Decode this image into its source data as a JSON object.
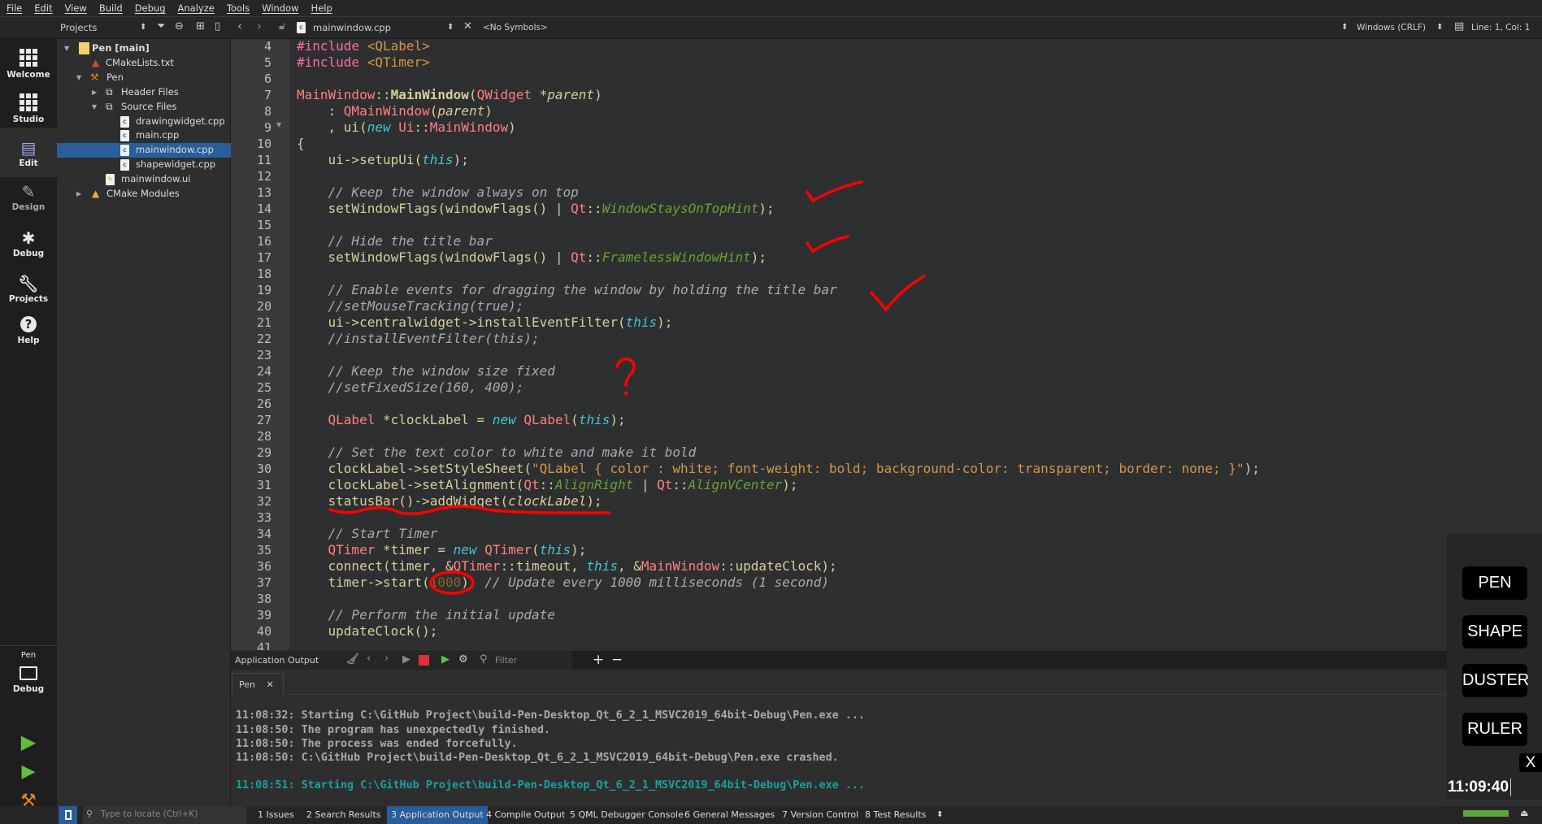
{
  "menu": [
    "File",
    "Edit",
    "View",
    "Build",
    "Debug",
    "Analyze",
    "Tools",
    "Window",
    "Help"
  ],
  "projects_panel": {
    "title": "Projects",
    "items": [
      {
        "label": "Pen [main]",
        "bold": true
      },
      {
        "label": "CMakeLists.txt"
      },
      {
        "label": "Pen"
      },
      {
        "label": "Header Files"
      },
      {
        "label": "Source Files"
      },
      {
        "label": "drawingwidget.cpp"
      },
      {
        "label": "main.cpp"
      },
      {
        "label": "mainwindow.cpp",
        "selected": true
      },
      {
        "label": "shapewidget.cpp"
      },
      {
        "label": "mainwindow.ui"
      },
      {
        "label": "CMake Modules"
      }
    ]
  },
  "editor_toolbar": {
    "filename": "mainwindow.cpp",
    "symbols": "<No Symbols>",
    "line_ending": "Windows (CRLF)",
    "cursor": "Line: 1, Col: 1"
  },
  "modes": [
    {
      "label": "Welcome",
      "icon": "grid-icon"
    },
    {
      "label": "Studio",
      "icon": "grid-icon"
    },
    {
      "label": "Edit",
      "icon": "document-icon",
      "active": true
    },
    {
      "label": "Design",
      "icon": "pencil-icon"
    },
    {
      "label": "Debug",
      "icon": "bug-icon"
    },
    {
      "label": "Projects",
      "icon": "wrench-icon"
    },
    {
      "label": "Help",
      "icon": "help-icon"
    }
  ],
  "kit": {
    "project": "Pen",
    "config": "Debug"
  },
  "code": {
    "first_line": 4,
    "lines": [
      [
        [
          "p",
          "#include"
        ],
        [
          "",
          " "
        ],
        [
          "i",
          "<QLabel>"
        ]
      ],
      [
        [
          "p",
          "#include"
        ],
        [
          "",
          " "
        ],
        [
          "i",
          "<QTimer>"
        ]
      ],
      [],
      [
        [
          "t",
          "MainWindow"
        ],
        [
          "",
          "::"
        ],
        [
          "fb",
          "MainWindow"
        ],
        [
          "",
          "("
        ],
        [
          "t",
          "QWidget"
        ],
        [
          "",
          " *"
        ],
        [
          "v",
          "parent"
        ],
        [
          "",
          ")"
        ]
      ],
      [
        [
          "",
          "    : "
        ],
        [
          "t",
          "QMainWindow"
        ],
        [
          "",
          "("
        ],
        [
          "v",
          "parent"
        ],
        [
          "",
          ")"
        ]
      ],
      [
        [
          "",
          "    , ui("
        ],
        [
          "n",
          "new"
        ],
        [
          "",
          " "
        ],
        [
          "t",
          "Ui"
        ],
        [
          "",
          "::"
        ],
        [
          "t",
          "MainWindow"
        ],
        [
          "",
          ")"
        ]
      ],
      [
        [
          "",
          "{"
        ]
      ],
      [
        [
          "",
          "    ui->setupUi("
        ],
        [
          "n",
          "this"
        ],
        [
          "",
          ");"
        ]
      ],
      [],
      [
        [
          "c",
          "    // Keep the window always on top"
        ]
      ],
      [
        [
          "",
          "    setWindowFlags(windowFlags() | "
        ],
        [
          "t",
          "Qt"
        ],
        [
          "",
          "::"
        ],
        [
          "e",
          "WindowStaysOnTopHint"
        ],
        [
          "",
          ");"
        ]
      ],
      [],
      [
        [
          "c",
          "    // Hide the title bar"
        ]
      ],
      [
        [
          "",
          "    setWindowFlags(windowFlags() | "
        ],
        [
          "t",
          "Qt"
        ],
        [
          "",
          "::"
        ],
        [
          "e",
          "FramelessWindowHint"
        ],
        [
          "",
          ");"
        ]
      ],
      [],
      [
        [
          "c",
          "    // Enable events for dragging the window by holding the title bar"
        ]
      ],
      [
        [
          "c",
          "    //setMouseTracking(true);"
        ]
      ],
      [
        [
          "",
          "    ui->centralwidget->installEventFilter("
        ],
        [
          "n",
          "this"
        ],
        [
          "",
          ");"
        ]
      ],
      [
        [
          "c",
          "    //installEventFilter(this);"
        ]
      ],
      [],
      [
        [
          "c",
          "    // Keep the window size fixed"
        ]
      ],
      [
        [
          "c",
          "    //setFixedSize(160, 400);"
        ]
      ],
      [],
      [
        [
          "",
          "    "
        ],
        [
          "t",
          "QLabel"
        ],
        [
          "",
          " *clockLabel = "
        ],
        [
          "n",
          "new"
        ],
        [
          "",
          " "
        ],
        [
          "t",
          "QLabel"
        ],
        [
          "",
          "("
        ],
        [
          "n",
          "this"
        ],
        [
          "",
          ");"
        ]
      ],
      [],
      [
        [
          "c",
          "    // Set the text color to white and make it bold"
        ]
      ],
      [
        [
          "",
          "    clockLabel->setStyleSheet("
        ],
        [
          "s",
          "\"QLabel { color : white; font-weight: bold; background-color: transparent; border: none; }\""
        ],
        [
          "",
          ");"
        ]
      ],
      [
        [
          "",
          "    clockLabel->setAlignment("
        ],
        [
          "t",
          "Qt"
        ],
        [
          "",
          "::"
        ],
        [
          "e",
          "AlignRight"
        ],
        [
          "",
          " | "
        ],
        [
          "t",
          "Qt"
        ],
        [
          "",
          "::"
        ],
        [
          "e",
          "AlignVCenter"
        ],
        [
          "",
          ");"
        ]
      ],
      [
        [
          "",
          "    statusBar()->addWidget("
        ],
        [
          "v",
          "clockLabel"
        ],
        [
          "",
          ");"
        ]
      ],
      [],
      [
        [
          "c",
          "    // Start Timer"
        ]
      ],
      [
        [
          "",
          "    "
        ],
        [
          "t",
          "QTimer"
        ],
        [
          "",
          " *timer = "
        ],
        [
          "n",
          "new"
        ],
        [
          "",
          " "
        ],
        [
          "t",
          "QTimer"
        ],
        [
          "",
          "("
        ],
        [
          "n",
          "this"
        ],
        [
          "",
          ");"
        ]
      ],
      [
        [
          "",
          "    connect(timer, &"
        ],
        [
          "t",
          "QTimer"
        ],
        [
          "",
          "::timeout, "
        ],
        [
          "n",
          "this"
        ],
        [
          "",
          ", &"
        ],
        [
          "t",
          "MainWindow"
        ],
        [
          "",
          "::updateClock);"
        ]
      ],
      [
        [
          "",
          "    timer->start("
        ],
        [
          "d",
          "1000"
        ],
        [
          "",
          "); "
        ],
        [
          "c",
          "// Update every 1000 milliseconds (1 second)"
        ]
      ],
      [],
      [
        [
          "c",
          "    // Perform the initial update"
        ]
      ],
      [
        [
          "",
          "    updateClock();"
        ]
      ],
      []
    ]
  },
  "output": {
    "title": "Application Output",
    "filter_placeholder": "Filter",
    "tab": "Pen",
    "lines": [
      {
        "text": "11:08:32: Starting C:\\GitHub Project\\build-Pen-Desktop_Qt_6_2_1_MSVC2019_64bit-Debug\\Pen.exe ..."
      },
      {
        "text": "11:08:50: The program has unexpectedly finished."
      },
      {
        "text": "11:08:50: The process was ended forcefully."
      },
      {
        "text": "11:08:50: C:\\GitHub Project\\build-Pen-Desktop_Qt_6_2_1_MSVC2019_64bit-Debug\\Pen.exe crashed."
      },
      {
        "text": "11:08:51: Starting C:\\GitHub Project\\build-Pen-Desktop_Qt_6_2_1_MSVC2019_64bit-Debug\\Pen.exe ...",
        "highlight": true
      }
    ]
  },
  "statusbar": {
    "locate_placeholder": "Type to locate (Ctrl+K)",
    "panes": [
      "1  Issues",
      "2  Search Results",
      "3  Application Output",
      "4  Compile Output",
      "5  QML Debugger Console",
      "6  General Messages",
      "7  Version Control",
      "8  Test Results"
    ],
    "active_pane": 2,
    "progress": 1.0
  },
  "pen_app": {
    "buttons": [
      "PEN",
      "SHAPE",
      "DUSTER",
      "RULER"
    ],
    "close": "X",
    "clock": "11:09:40"
  },
  "colors": {
    "accent": "#2a5d9b",
    "annotation": "#ff0000",
    "progress": "#5aa83c",
    "output_highlight": "#1aa0a0"
  }
}
